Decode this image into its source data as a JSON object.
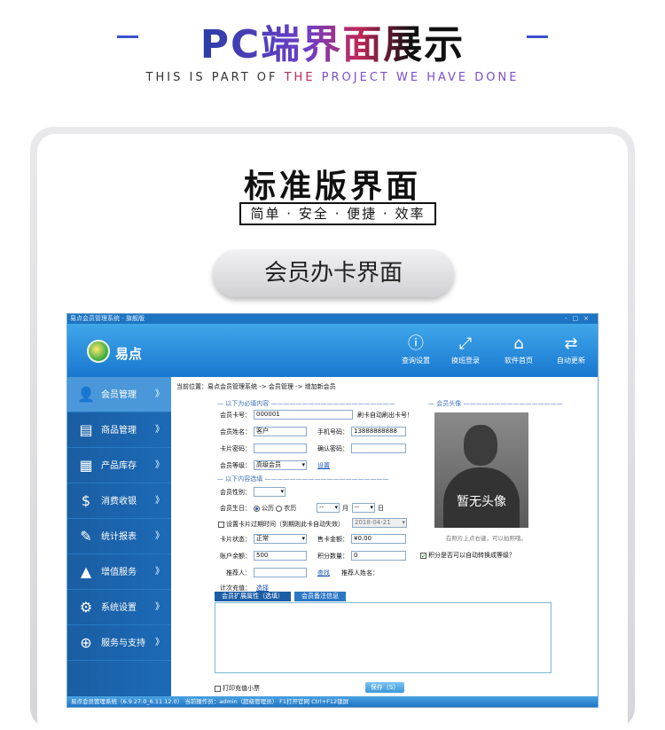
{
  "banner": {
    "title": "PC端界面展示",
    "subtitle_parts": [
      "THIS IS PART OF ",
      "THE",
      " PROJECT",
      " WE HAVE DONE"
    ]
  },
  "section": {
    "title": "标准版界面",
    "tagline": "简单 · 安全 · 便捷 · 效率",
    "pill": "会员办卡界面"
  },
  "app": {
    "window_title": "易点会员管理系统 - 旗舰版",
    "window_controls": [
      "-",
      "□",
      "×"
    ],
    "logo_text": "易点",
    "toolbar": [
      {
        "icon": "info-icon",
        "glyph": "ⓘ",
        "label": "查询设置"
      },
      {
        "icon": "switch-icon",
        "glyph": "⤢",
        "label": "换班登录"
      },
      {
        "icon": "home-icon",
        "glyph": "⌂",
        "label": "软件首页"
      },
      {
        "icon": "refresh-icon",
        "glyph": "⇄",
        "label": "自动更新"
      }
    ],
    "sidebar": [
      {
        "icon": "member-icon",
        "glyph": "👤",
        "label": "会员管理",
        "active": true
      },
      {
        "icon": "goods-icon",
        "glyph": "▤",
        "label": "商品管理"
      },
      {
        "icon": "stock-icon",
        "glyph": "▦",
        "label": "产品库存"
      },
      {
        "icon": "cashier-icon",
        "glyph": "$",
        "label": "消费收银"
      },
      {
        "icon": "report-icon",
        "glyph": "✎",
        "label": "统计报表"
      },
      {
        "icon": "value-icon",
        "glyph": "▲",
        "label": "增值服务"
      },
      {
        "icon": "settings-icon",
        "glyph": "⚙",
        "label": "系统设置"
      },
      {
        "icon": "service-icon",
        "glyph": "⊕",
        "label": "服务与支持"
      }
    ],
    "chevron": "》",
    "breadcrumb": "当前位置：易点会员管理系统 -> 会员管理 -> 增加新会员",
    "form": {
      "section_required": "以下为必填内容",
      "section_optional": "以下内容选填",
      "section_avatar": "会员头像",
      "card_no_label": "会员卡号：",
      "card_no_value": "000001",
      "card_no_hint": "刷卡自动刷出卡号！",
      "name_label": "会员姓名：",
      "name_value": "客户",
      "phone_label": "手机号码：",
      "phone_value": "13888888888",
      "pwd_label": "卡片密码：",
      "confirm_label": "确认密码：",
      "level_label": "会员等级：",
      "level_value": "高级会员",
      "level_link": "设置",
      "gender_label": "会员性别：",
      "birthday_label": "会员生日：",
      "calendar_solar": "公历",
      "calendar_lunar": "农历",
      "month_unit": "月",
      "day_unit": "日",
      "dash_value": "--",
      "expire_label": "设置卡片过期时间（到期则此卡自动失效）",
      "expire_value": "2018-04-21",
      "status_label": "卡片状态：",
      "status_value": "正常",
      "sale_label": "售卡金额：",
      "sale_value": "¥0.00",
      "points_auto_label": "积分是否可以自动转换成等级？",
      "balance_label": "账户余额：",
      "balance_value": "500",
      "points_label": "积分数量：",
      "points_value": "0",
      "referrer_label": "推荐人：",
      "find_link": "查找",
      "referrer_name_label": "推荐人姓名：",
      "count_label": "计次充值：",
      "select_link": "选择",
      "avatar_placeholder": "暂无头像",
      "avatar_hint": "在照片上点右键，可以拍照哦。",
      "tabs": [
        "会员扩展属性（选填）",
        "会员备注信息"
      ],
      "print_label": "打印充值小票",
      "save_label": "保存（S）"
    },
    "statusbar": "易点会员管理系统（6.9.27.0_6.11.12.0）  当前操作员：admin（超级管理员）  F1打开官网  Ctrl+F12锁屏"
  }
}
